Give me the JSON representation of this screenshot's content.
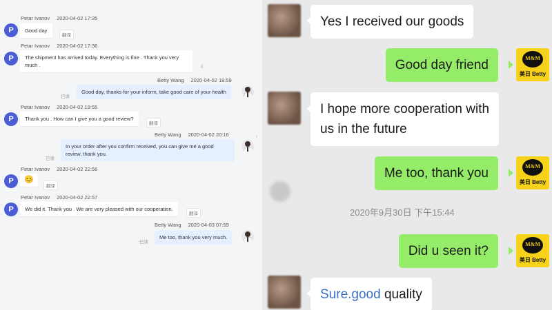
{
  "left_chat": {
    "messages": [
      {
        "sender": "Petar Ivanov",
        "time": "2020-04-02 17:35",
        "avatar": "P",
        "text": "Good day",
        "translate": "翻译"
      },
      {
        "sender": "Petar Ivanov",
        "time": "2020-04-02 17:36",
        "avatar": "P",
        "text_line1": "The shipment has arrived today. Everything is fine . Thank you very",
        "text_line2": "much ."
      },
      {
        "sender": "Betty Wang",
        "time": "2020-04-02 18:59",
        "text": "Good day, thanks for your inform, take good care of your health",
        "read": "已读"
      },
      {
        "sender": "Petar Ivanov",
        "time": "2020-04-02 19:55",
        "avatar": "P",
        "text": "Thank you . How can I give you a good review?",
        "translate": "翻译"
      },
      {
        "sender": "Betty Wang",
        "time": "2020-04-02 20:16",
        "text_line1": "In your order after you confirm received, you can give me a good",
        "text_line2": "review, thank you.",
        "read": "已读"
      },
      {
        "sender": "Petar Ivanov",
        "time": "2020-04-02 22:56",
        "avatar": "P",
        "emoji": "😊",
        "translate": "翻译"
      },
      {
        "sender": "Petar Ivanov",
        "time": "2020-04-02 22:57",
        "avatar": "P",
        "text": "We did it. Thank you . We are very pleased with our cooperation.",
        "translate": "翻译"
      },
      {
        "sender": "Betty Wang",
        "time": "2020-04-03 07:59",
        "text": "Me too, thank you very much.",
        "read": "已读"
      }
    ],
    "scroll_marks": [
      "ⅱ",
      "‹"
    ]
  },
  "right_chat": {
    "messages": [
      {
        "side": "in",
        "text": "Yes I received our goods"
      },
      {
        "side": "out",
        "text": "Good day friend"
      },
      {
        "side": "in",
        "text_line1": "I hope more cooperation with",
        "text_line2": "us in the future"
      },
      {
        "side": "out",
        "text": "Me too, thank you"
      },
      {
        "side": "out",
        "text": "Did u seen it?"
      },
      {
        "side": "in",
        "text_blue": "Sure.good",
        "text_rest": " quality"
      }
    ],
    "timestamp": "2020年9月30日 下午15:44",
    "logo": {
      "mark": "M&M",
      "caption": "美日 Betty"
    }
  },
  "colors": {
    "left_avatar": "#4a5cd6",
    "self_bubble": "#e5efff",
    "green_bubble": "#95ec69",
    "logo_bg": "#f7d21b"
  }
}
